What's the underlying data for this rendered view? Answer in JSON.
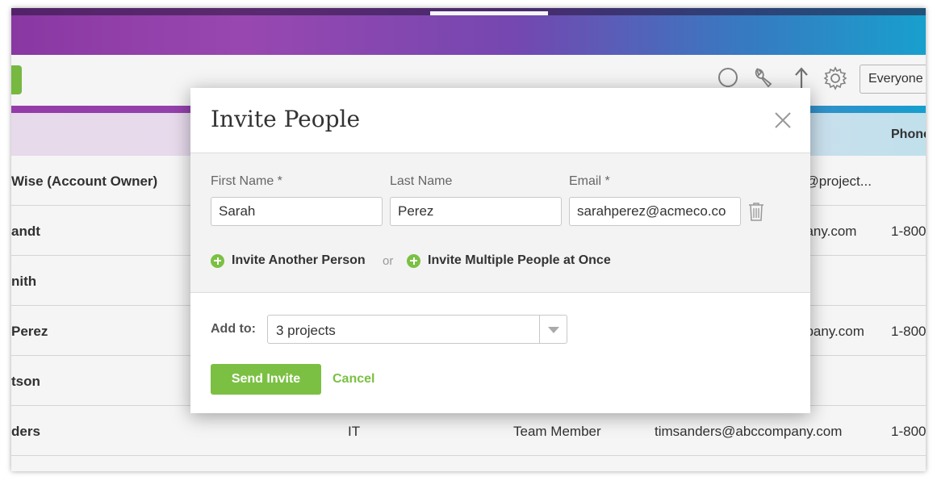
{
  "toolbar": {
    "filter_value": "Everyone"
  },
  "table": {
    "header_phone": "Phone",
    "rows": [
      {
        "name": "Wise (Account Owner)",
        "dept": "",
        "role": "",
        "email": "x@project...",
        "phone": ""
      },
      {
        "name": "andt",
        "dept": "",
        "role": "",
        "email": "pany.com",
        "phone": "1-800"
      },
      {
        "name": "nith",
        "dept": "",
        "role": "",
        "email": "",
        "phone": ""
      },
      {
        "name": "Perez",
        "dept": "",
        "role": "",
        "email": "npany.com",
        "phone": "1-800"
      },
      {
        "name": "tson",
        "dept": "",
        "role": "",
        "email": "",
        "phone": ""
      },
      {
        "name": "ders",
        "dept": "IT",
        "role": "Team Member",
        "email": "timsanders@abccompany.com",
        "phone": "1-800"
      }
    ]
  },
  "modal": {
    "title": "Invite People",
    "first_name_label": "First Name *",
    "last_name_label": "Last Name",
    "email_label": "Email *",
    "first_name_value": "Sarah",
    "last_name_value": "Perez",
    "email_value": "sarahperez@acmeco.co",
    "invite_another": "Invite Another Person",
    "or_text": "or",
    "invite_multiple": "Invite Multiple People at Once",
    "add_to_label": "Add to:",
    "add_to_value": "3 projects",
    "send_label": "Send Invite",
    "cancel_label": "Cancel"
  },
  "colors": {
    "accent_green": "#7bc043",
    "banner_purple": "#8f3aa9",
    "banner_blue": "#1aa7d6"
  },
  "icons": [
    "search-icon",
    "wrench-icon",
    "arrow-up-icon",
    "gear-icon",
    "close-icon",
    "trash-icon",
    "plus-circle-icon",
    "chevron-down-icon"
  ]
}
